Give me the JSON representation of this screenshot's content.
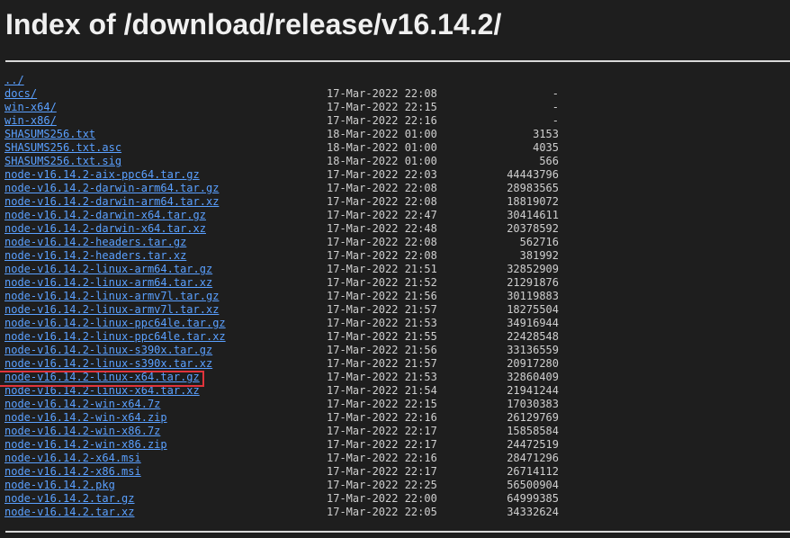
{
  "page": {
    "title": "Index of /download/release/v16.14.2/"
  },
  "highlight": {
    "color": "#e0343b",
    "target": "node-v16.14.2-linux-x64.tar.gz"
  },
  "rows": [
    {
      "name": "../",
      "date": "",
      "size": ""
    },
    {
      "name": "docs/",
      "date": "17-Mar-2022 22:08",
      "size": "-"
    },
    {
      "name": "win-x64/",
      "date": "17-Mar-2022 22:15",
      "size": "-"
    },
    {
      "name": "win-x86/",
      "date": "17-Mar-2022 22:16",
      "size": "-"
    },
    {
      "name": "SHASUMS256.txt",
      "date": "18-Mar-2022 01:00",
      "size": "3153"
    },
    {
      "name": "SHASUMS256.txt.asc",
      "date": "18-Mar-2022 01:00",
      "size": "4035"
    },
    {
      "name": "SHASUMS256.txt.sig",
      "date": "18-Mar-2022 01:00",
      "size": "566"
    },
    {
      "name": "node-v16.14.2-aix-ppc64.tar.gz",
      "date": "17-Mar-2022 22:03",
      "size": "44443796"
    },
    {
      "name": "node-v16.14.2-darwin-arm64.tar.gz",
      "date": "17-Mar-2022 22:08",
      "size": "28983565"
    },
    {
      "name": "node-v16.14.2-darwin-arm64.tar.xz",
      "date": "17-Mar-2022 22:08",
      "size": "18819072"
    },
    {
      "name": "node-v16.14.2-darwin-x64.tar.gz",
      "date": "17-Mar-2022 22:47",
      "size": "30414611"
    },
    {
      "name": "node-v16.14.2-darwin-x64.tar.xz",
      "date": "17-Mar-2022 22:48",
      "size": "20378592"
    },
    {
      "name": "node-v16.14.2-headers.tar.gz",
      "date": "17-Mar-2022 22:08",
      "size": "562716"
    },
    {
      "name": "node-v16.14.2-headers.tar.xz",
      "date": "17-Mar-2022 22:08",
      "size": "381992"
    },
    {
      "name": "node-v16.14.2-linux-arm64.tar.gz",
      "date": "17-Mar-2022 21:51",
      "size": "32852909"
    },
    {
      "name": "node-v16.14.2-linux-arm64.tar.xz",
      "date": "17-Mar-2022 21:52",
      "size": "21291876"
    },
    {
      "name": "node-v16.14.2-linux-armv7l.tar.gz",
      "date": "17-Mar-2022 21:56",
      "size": "30119883"
    },
    {
      "name": "node-v16.14.2-linux-armv7l.tar.xz",
      "date": "17-Mar-2022 21:57",
      "size": "18275504"
    },
    {
      "name": "node-v16.14.2-linux-ppc64le.tar.gz",
      "date": "17-Mar-2022 21:53",
      "size": "34916944"
    },
    {
      "name": "node-v16.14.2-linux-ppc64le.tar.xz",
      "date": "17-Mar-2022 21:55",
      "size": "22428548"
    },
    {
      "name": "node-v16.14.2-linux-s390x.tar.gz",
      "date": "17-Mar-2022 21:56",
      "size": "33136559"
    },
    {
      "name": "node-v16.14.2-linux-s390x.tar.xz",
      "date": "17-Mar-2022 21:57",
      "size": "20917280"
    },
    {
      "name": "node-v16.14.2-linux-x64.tar.gz",
      "date": "17-Mar-2022 21:53",
      "size": "32860409"
    },
    {
      "name": "node-v16.14.2-linux-x64.tar.xz",
      "date": "17-Mar-2022 21:54",
      "size": "21941244"
    },
    {
      "name": "node-v16.14.2-win-x64.7z",
      "date": "17-Mar-2022 22:15",
      "size": "17030383"
    },
    {
      "name": "node-v16.14.2-win-x64.zip",
      "date": "17-Mar-2022 22:16",
      "size": "26129769"
    },
    {
      "name": "node-v16.14.2-win-x86.7z",
      "date": "17-Mar-2022 22:17",
      "size": "15858584"
    },
    {
      "name": "node-v16.14.2-win-x86.zip",
      "date": "17-Mar-2022 22:17",
      "size": "24472519"
    },
    {
      "name": "node-v16.14.2-x64.msi",
      "date": "17-Mar-2022 22:16",
      "size": "28471296"
    },
    {
      "name": "node-v16.14.2-x86.msi",
      "date": "17-Mar-2022 22:17",
      "size": "26714112"
    },
    {
      "name": "node-v16.14.2.pkg",
      "date": "17-Mar-2022 22:25",
      "size": "56500904"
    },
    {
      "name": "node-v16.14.2.tar.gz",
      "date": "17-Mar-2022 22:00",
      "size": "64999385"
    },
    {
      "name": "node-v16.14.2.tar.xz",
      "date": "17-Mar-2022 22:05",
      "size": "34332624"
    }
  ]
}
